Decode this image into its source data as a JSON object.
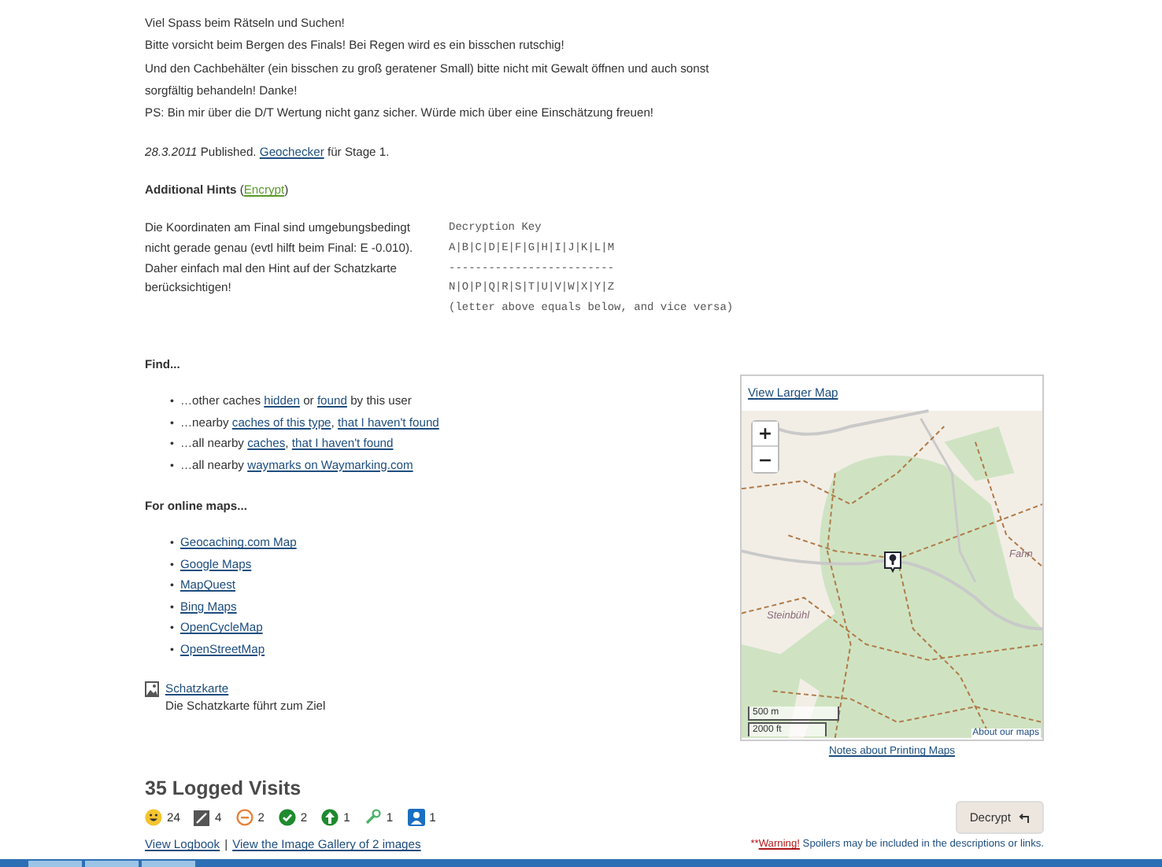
{
  "description": {
    "lines": [
      "Viel Spass beim Rätseln und Suchen!",
      "Bitte vorsicht beim Bergen des Finals! Bei Regen wird es ein bisschen rutschig!",
      "Und den Cachbehälter (ein bisschen zu groß geratener Small) bitte nicht mit Gewalt öffnen und auch sonst sorgfältig behandeln! Danke!",
      "PS: Bin mir über die D/T Wertung nicht ganz sicher. Würde mich über eine Einschätzung freuen!"
    ]
  },
  "published": {
    "date": "28.3.2011",
    "text": "Published.",
    "link": "Geochecker",
    "suffix": "für Stage 1."
  },
  "hints": {
    "title": "Additional Hints",
    "toggle_open": "(",
    "toggle": "Encrypt",
    "toggle_close": ")",
    "text": "Die Koordinaten am Final sind umgebungsbedingt nicht gerade genau (evtl hilft beim Final: E -0.010). Daher einfach mal den Hint auf der Schatzkarte berücksichtigen!",
    "key": {
      "title": "Decryption Key",
      "row1": "A|B|C|D|E|F|G|H|I|J|K|L|M",
      "separator": "-------------------------",
      "row2": "N|O|P|Q|R|S|T|U|V|W|X|Y|Z",
      "note": "(letter above equals below, and vice versa)"
    }
  },
  "find": {
    "title": "Find...",
    "items": [
      {
        "marker": "•",
        "parts": [
          {
            "kind": "text",
            "text": "…other caches "
          },
          {
            "kind": "link",
            "text": "hidden"
          },
          {
            "kind": "text",
            "text": " or "
          },
          {
            "kind": "link",
            "text": "found"
          },
          {
            "kind": "text",
            "text": " by this user"
          }
        ]
      },
      {
        "marker": "•",
        "parts": [
          {
            "kind": "text",
            "text": "…nearby "
          },
          {
            "kind": "link",
            "text": "caches of this type"
          },
          {
            "kind": "text",
            "text": ", "
          },
          {
            "kind": "link",
            "text": "that I haven't found"
          }
        ]
      },
      {
        "marker": "•",
        "parts": [
          {
            "kind": "text",
            "text": "…all nearby "
          },
          {
            "kind": "link",
            "text": "caches"
          },
          {
            "kind": "text",
            "text": ", "
          },
          {
            "kind": "link",
            "text": "that I haven't found"
          }
        ]
      },
      {
        "marker": "•",
        "parts": [
          {
            "kind": "text",
            "text": "…all nearby "
          },
          {
            "kind": "link",
            "text": "waymarks on Waymarking.com"
          }
        ]
      }
    ]
  },
  "maps": {
    "title": "For online maps...",
    "links": [
      {
        "marker": "•",
        "text": "Geocaching.com Map"
      },
      {
        "marker": "•",
        "text": "Google Maps"
      },
      {
        "marker": "•",
        "text": "MapQuest"
      },
      {
        "marker": "•",
        "text": "Bing Maps"
      },
      {
        "marker": "•",
        "text": "OpenCycleMap"
      },
      {
        "marker": "•",
        "text": "OpenStreetMap"
      }
    ]
  },
  "attachment": {
    "link": "Schatzkarte",
    "caption": "Die Schatzkarte führt zum Ziel"
  },
  "map_panel": {
    "header_link": "View Larger Map",
    "zoom_in": "+",
    "zoom_out": "−",
    "place_labels": [
      "Steinbühl",
      "Fahn"
    ],
    "scale": [
      "500 m",
      "2000 ft"
    ],
    "attribution": "About our maps",
    "footer_link": "Notes about Printing Maps"
  },
  "logs": {
    "title": "35 Logged Visits",
    "counts": [
      {
        "kind": "found",
        "count": "24"
      },
      {
        "kind": "note",
        "count": "4"
      },
      {
        "kind": "not-found",
        "count": "2"
      },
      {
        "kind": "published",
        "count": "2"
      },
      {
        "kind": "enabled",
        "count": "1"
      },
      {
        "kind": "maintenance",
        "count": "1"
      },
      {
        "kind": "reviewer",
        "count": "1"
      }
    ],
    "decrypt": "Decrypt",
    "links": [
      "View Logbook",
      "View the Image Gallery of 2 images"
    ],
    "link_separator": "|",
    "warning": {
      "prefix": "**",
      "link": "Warning!",
      "text": "Spoilers may be included in the descriptions or links."
    }
  }
}
